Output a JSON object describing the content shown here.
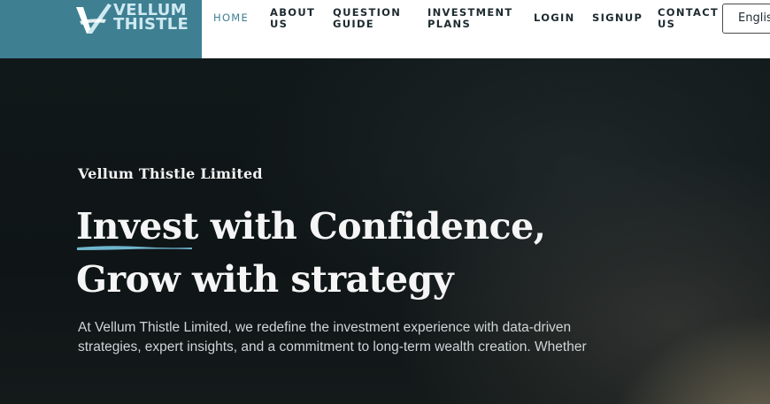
{
  "brand": {
    "line1": "VELLUM",
    "line2": "THISTLE",
    "colors": {
      "panel": "#3e7f92",
      "text": "#cfe9f1"
    },
    "icon": "v-checkmark-logo-icon"
  },
  "nav": {
    "items": [
      {
        "line1": "HOME",
        "line2": "",
        "active": true
      },
      {
        "line1": "ABOUT",
        "line2": "US",
        "active": false
      },
      {
        "line1": "QUESTION",
        "line2": "GUIDE",
        "active": false
      },
      {
        "line1": "INVESTMENT",
        "line2": "PLANS",
        "active": false
      },
      {
        "line1": "LOGIN",
        "line2": "",
        "active": false
      },
      {
        "line1": "SIGNUP",
        "line2": "",
        "active": false
      },
      {
        "line1": "CONTACT",
        "line2": "US",
        "active": false
      }
    ],
    "language": "English"
  },
  "hero": {
    "company": "Vellum Thistle Limited",
    "headline_highlight": "Invest",
    "headline_rest_line1": " with Confidence,",
    "headline_line2": "Grow with strategy",
    "description": "At Vellum Thistle Limited, we redefine the investment experience with data-driven strategies, expert insights, and a commitment to long-term wealth creation. Whether",
    "accent_color": "#6fb6cf"
  }
}
